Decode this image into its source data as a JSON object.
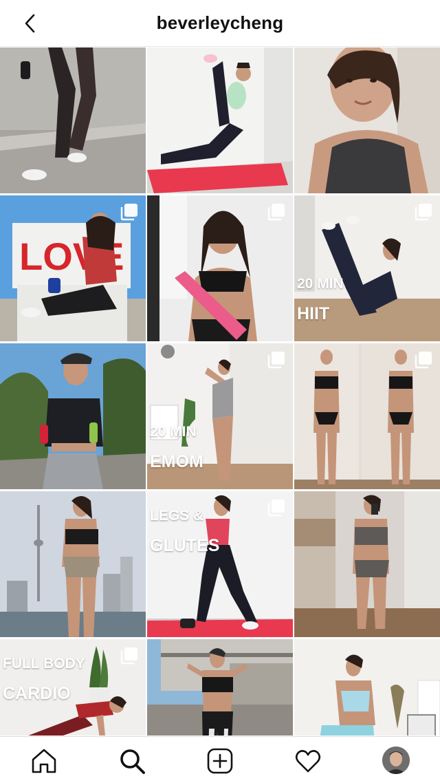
{
  "header": {
    "title": "beverleycheng",
    "back_icon": "chevron-left-icon"
  },
  "grid": {
    "posts": [
      {
        "id": 1,
        "multi": false,
        "overlay": ""
      },
      {
        "id": 2,
        "multi": false,
        "overlay": ""
      },
      {
        "id": 3,
        "multi": false,
        "overlay": ""
      },
      {
        "id": 4,
        "multi": true,
        "overlay": ""
      },
      {
        "id": 5,
        "multi": true,
        "overlay": ""
      },
      {
        "id": 6,
        "multi": true,
        "overlay_line1": "20 MIN",
        "overlay_line2": "HIIT"
      },
      {
        "id": 7,
        "multi": false,
        "overlay": ""
      },
      {
        "id": 8,
        "multi": true,
        "overlay_line1": "20 MIN",
        "overlay_line2": "EMOM"
      },
      {
        "id": 9,
        "multi": true,
        "overlay": ""
      },
      {
        "id": 10,
        "multi": false,
        "overlay": ""
      },
      {
        "id": 11,
        "multi": true,
        "overlay_line1": "LEGS &",
        "overlay_line2": "GLUTES"
      },
      {
        "id": 12,
        "multi": false,
        "overlay": ""
      },
      {
        "id": 13,
        "multi": true,
        "overlay_line1": "FULL BODY",
        "overlay_line2": "CARDIO"
      },
      {
        "id": 14,
        "multi": false,
        "overlay": ""
      },
      {
        "id": 15,
        "multi": false,
        "overlay": ""
      }
    ]
  },
  "tabbar": {
    "items": [
      "home-icon",
      "search-icon",
      "new-post-icon",
      "heart-icon",
      "profile-avatar"
    ]
  },
  "colors": {
    "text": "#111111",
    "divider": "#e6e6e6",
    "mat_red": "#e8394f",
    "mat_pink": "#ec5c8a"
  }
}
